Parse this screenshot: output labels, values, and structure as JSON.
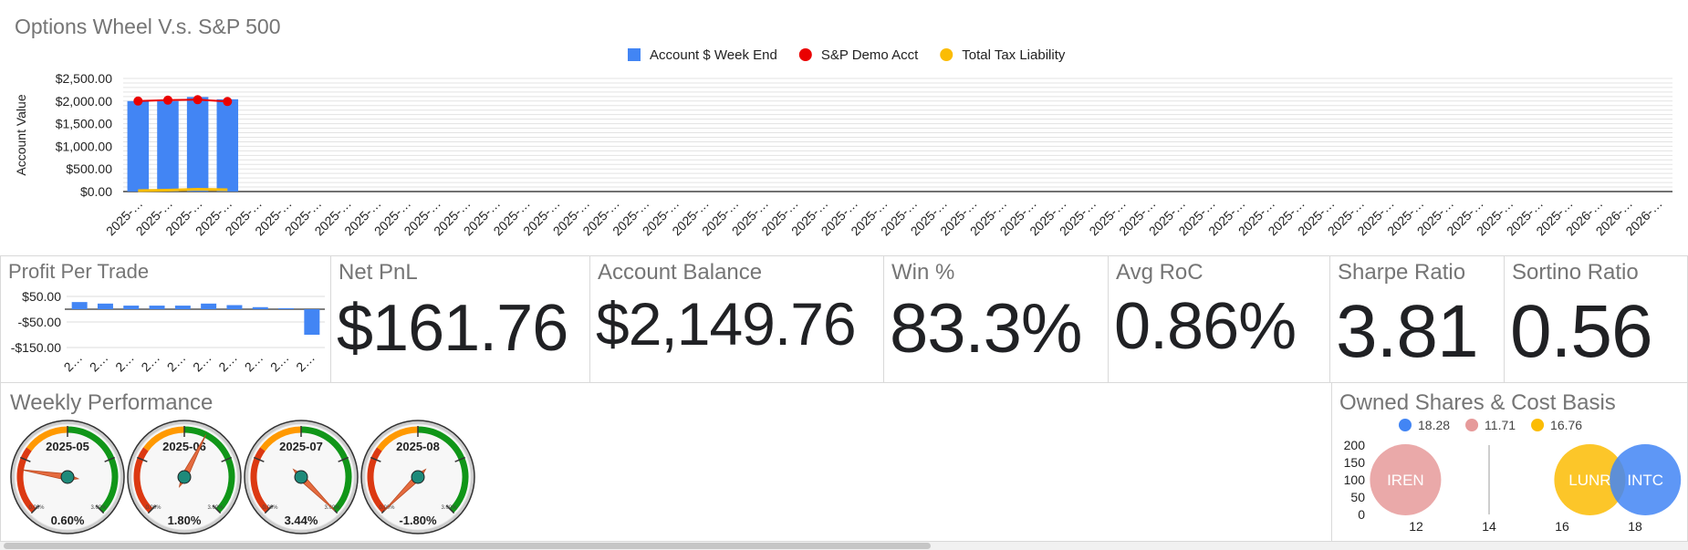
{
  "main_chart": {
    "title": "Options Wheel V.s. S&P 500",
    "ylabel": "Account Value",
    "legend": [
      {
        "label": "Account $ Week End",
        "color": "#4285f4",
        "shape": "square"
      },
      {
        "label": "S&P Demo Acct",
        "color": "#ea0000",
        "shape": "circle"
      },
      {
        "label": "Total Tax Liability",
        "color": "#fbbc04",
        "shape": "circle"
      }
    ],
    "yticks": [
      "$2,500.00",
      "$2,000.00",
      "$1,500.00",
      "$1,000.00",
      "$500.00",
      "$0.00"
    ],
    "xtick_labels": [
      "2025-…",
      "2025-…",
      "2025-…",
      "2025-…",
      "2025-…",
      "2025-…",
      "2025-…",
      "2025-…",
      "2025-…",
      "2025-…",
      "2025-…",
      "2025-…",
      "2025-…",
      "2025-…",
      "2025-…",
      "2025-…",
      "2025-…",
      "2025-…",
      "2025-…",
      "2025-…",
      "2025-…",
      "2025-…",
      "2025-…",
      "2025-…",
      "2025-…",
      "2025-…",
      "2025-…",
      "2025-…",
      "2025-…",
      "2025-…",
      "2025-…",
      "2025-…",
      "2025-…",
      "2025-…",
      "2025-…",
      "2025-…",
      "2025-…",
      "2025-…",
      "2025-…",
      "2025-…",
      "2025-…",
      "2025-…",
      "2025-…",
      "2025-…",
      "2025-…",
      "2025-…",
      "2025-…",
      "2025-…",
      "2025-…",
      "2026-…",
      "2026-…",
      "2026-…"
    ]
  },
  "profit_per_trade": {
    "title": "Profit Per Trade",
    "yticks": [
      "$50.00",
      "-$50.00",
      "-$150.00"
    ],
    "xtick_labels": [
      "2…",
      "2…",
      "2…",
      "2…",
      "2…",
      "2…",
      "2…",
      "2…",
      "2…",
      "2…"
    ]
  },
  "kpis": [
    {
      "title": "Net PnL",
      "value": "$161.76"
    },
    {
      "title": "Account Balance",
      "value": "$2,149.76"
    },
    {
      "title": "Win %",
      "value": "83.3%"
    },
    {
      "title": "Avg RoC",
      "value": "0.86%"
    },
    {
      "title": "Sharpe Ratio",
      "value": "3.81"
    },
    {
      "title": "Sortino Ratio",
      "value": "0.56"
    }
  ],
  "weekly_performance": {
    "title": "Weekly Performance",
    "min_label": "0.00%",
    "max_label": "3.00%"
  },
  "owned_shares": {
    "title": "Owned Shares & Cost Basis",
    "legend": [
      {
        "label": "18.28",
        "color": "#4285f4"
      },
      {
        "label": "11.71",
        "color": "#e69a9a"
      },
      {
        "label": "16.76",
        "color": "#fbbc04"
      }
    ],
    "yticks": [
      "200",
      "150",
      "100",
      "50",
      "0"
    ],
    "xticks": [
      "12",
      "14",
      "16",
      "18"
    ]
  },
  "chart_data": [
    {
      "type": "bar",
      "title": "Options Wheel V.s. S&P 500",
      "ylabel": "Account Value",
      "ylim": [
        0,
        2500
      ],
      "grid": true,
      "legend_position": "top",
      "categories_count": 52,
      "series": [
        {
          "name": "Account $ Week End",
          "type": "bar",
          "color": "#4285f4",
          "values": [
            2000,
            2000,
            2090,
            2040
          ]
        },
        {
          "name": "S&P Demo Acct",
          "type": "line",
          "color": "#ea0000",
          "values": [
            2000,
            2020,
            2030,
            1990
          ]
        },
        {
          "name": "Total Tax Liability",
          "type": "line",
          "color": "#fbbc04",
          "values": [
            20,
            30,
            50,
            40
          ]
        }
      ]
    },
    {
      "type": "bar",
      "title": "Profit Per Trade",
      "ylim": [
        -150,
        50
      ],
      "grid": true,
      "series": [
        {
          "color": "#4285f4",
          "values": [
            28,
            22,
            14,
            14,
            14,
            22,
            16,
            8,
            4,
            -100
          ]
        }
      ]
    },
    {
      "type": "gauge",
      "title": "Weekly Performance",
      "range": [
        0,
        3
      ],
      "gauges": [
        {
          "label": "2025-05",
          "value": 0.6,
          "display": "0.60%"
        },
        {
          "label": "2025-06",
          "value": 1.8,
          "display": "1.80%"
        },
        {
          "label": "2025-07",
          "value": 3.44,
          "display": "3.44%"
        },
        {
          "label": "2025-08",
          "value": -1.8,
          "display": "-1.80%"
        }
      ]
    },
    {
      "type": "scatter",
      "title": "Owned Shares & Cost Basis",
      "xlim": [
        10.8,
        19.2
      ],
      "ylim": [
        0,
        200
      ],
      "bubbles": [
        {
          "label": "IREN",
          "x": 11.71,
          "y": 100,
          "size": 100,
          "color": "#e69a9a"
        },
        {
          "label": "LUNR",
          "x": 16.76,
          "y": 100,
          "size": 100,
          "color": "#fbbc04"
        },
        {
          "label": "INTC",
          "x": 18.28,
          "y": 100,
          "size": 100,
          "color": "#4285f4"
        }
      ]
    }
  ]
}
